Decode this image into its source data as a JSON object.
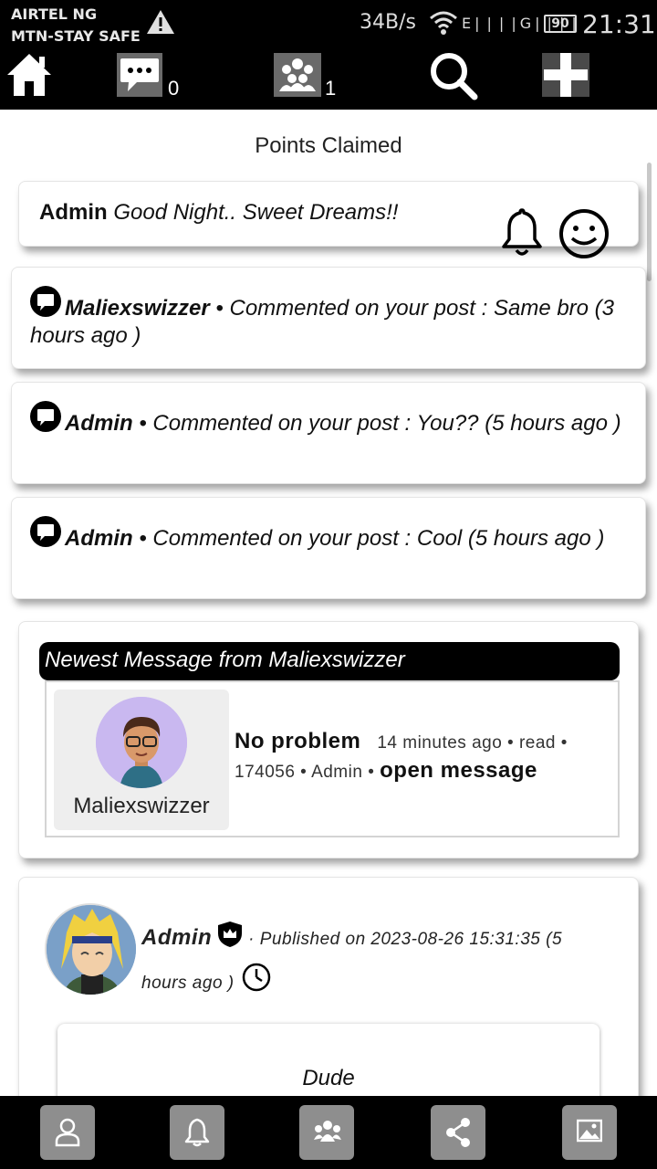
{
  "status_bar": {
    "carrier_1": "AIRTEL NG",
    "carrier_2": "MTN-STAY SAFE",
    "speed": "34B/s",
    "signal": "E❘❘❘❘G❘❘❘❘",
    "battery": "90",
    "time": "21:31"
  },
  "top_nav": {
    "messages_count": "0",
    "groups_count": "1",
    "icons": [
      "home-icon",
      "chat-icon",
      "group-icon",
      "search-icon",
      "plus-icon"
    ]
  },
  "page_title": "Points Claimed",
  "greeting": {
    "name": "Admin",
    "message": "Good Night.. Sweet Dreams!!"
  },
  "notifications": [
    {
      "user": "Maliexswizzer",
      "text": " • Commented on your post : Same bro (3 hours ago )"
    },
    {
      "user": "Admin",
      "text": " • Commented on your post : You?? (5 hours ago )"
    },
    {
      "user": "Admin",
      "text": " • Commented on your post : Cool (5 hours ago )"
    }
  ],
  "newest_message": {
    "header": "Newest Message from Maliexswizzer",
    "sender": "Maliexswizzer",
    "title": "No problem",
    "details": "14 minutes ago • read • 174056 • Admin • ",
    "open_link": "open message"
  },
  "post": {
    "author": "Admin",
    "published": "· Published on 2023-08-26 15:31:35 (5 hours ago )",
    "text": "Dude"
  },
  "bottom_bar": {
    "icons": [
      "profile-icon",
      "bell-icon",
      "group-icon",
      "share-icon",
      "image-icon"
    ]
  },
  "colors": {
    "bar_background": "#000000",
    "bottom_button": "#8e8e8e",
    "avatar_purple": "#c9b8f0"
  }
}
